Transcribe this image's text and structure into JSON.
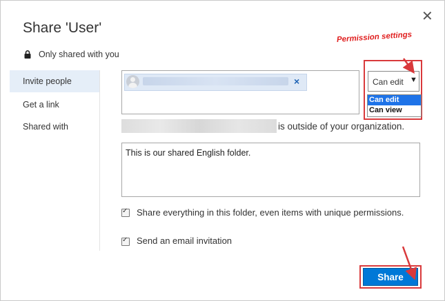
{
  "dialog": {
    "title": "Share 'User'",
    "close_glyph": "✕",
    "shared_status": "Only shared with you"
  },
  "sidebar": {
    "items": [
      {
        "label": "Invite people",
        "active": true
      },
      {
        "label": "Get a link",
        "active": false
      },
      {
        "label": "Shared with",
        "active": false
      }
    ]
  },
  "invite": {
    "recipient_remove_glyph": "×",
    "outside_org_text": "is outside of your organization.",
    "message": "This is our shared English folder."
  },
  "permission": {
    "selected": "Can edit",
    "arrow_glyph": "▼",
    "options": [
      "Can edit",
      "Can view"
    ],
    "annotation": "Permission settings"
  },
  "options": {
    "share_everything": {
      "checked": true,
      "label": "Share everything in this folder, even items with unique permissions."
    },
    "send_email": {
      "checked": true,
      "label": "Send an email invitation"
    }
  },
  "actions": {
    "share_label": "Share"
  },
  "colors": {
    "accent": "#0078d7",
    "annotation_red": "#d9393b",
    "sidebar_active": "#e5eef8"
  }
}
